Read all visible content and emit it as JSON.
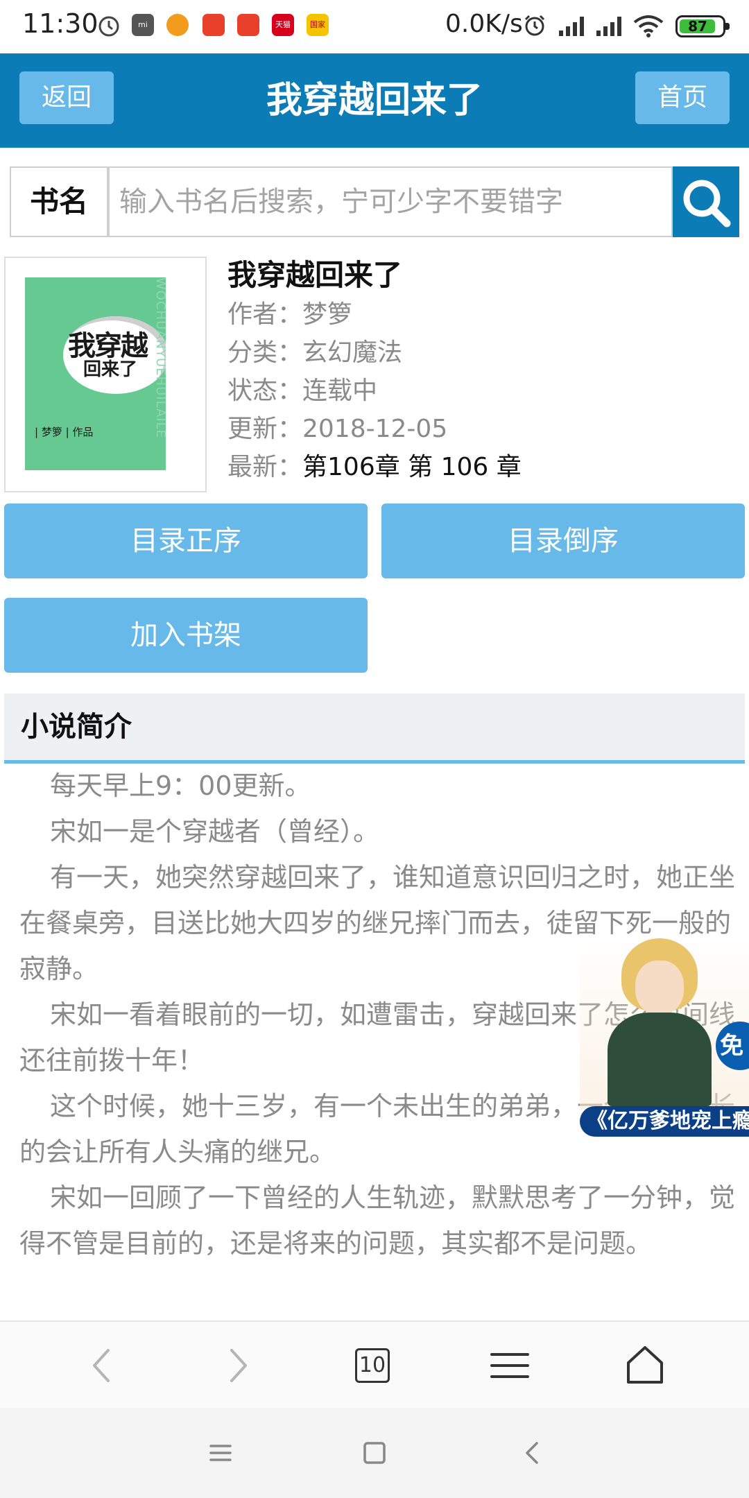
{
  "status_bar": {
    "time": "11:30",
    "net_speed": "0.0K/s",
    "battery": "87",
    "icons": [
      "alarm-icon",
      "mi-icon",
      "app-icon",
      "app-icon",
      "app-icon",
      "tmall-icon",
      "app-icon",
      "alarm-icon",
      "signal-icon",
      "signal-icon",
      "wifi-icon",
      "battery-icon"
    ],
    "app_labels": [
      "天猫",
      "国家"
    ]
  },
  "header": {
    "back_label": "返回",
    "title": "我穿越回来了",
    "home_label": "首页",
    "color": "#0b7cb6",
    "button_color": "#67b9ea"
  },
  "search": {
    "label": "书名",
    "placeholder": "输入书名后搜索，宁可少字不要错字",
    "icon": "search-icon"
  },
  "book": {
    "title": "我穿越回来了",
    "cover": {
      "title_line1": "我穿越",
      "title_line2": "回来了",
      "author": "| 梦箩 | 作品",
      "pinyin": "WOCHUANYUEHUILAILE",
      "color": "#66c992"
    },
    "author_label": "作者：",
    "author": "梦箩",
    "category_label": "分类：",
    "category": "玄幻魔法",
    "status_label": "状态：",
    "status": "连载中",
    "updated_label": "更新：",
    "updated": "2018-12-05",
    "latest_label": "最新：",
    "latest": "第106章 第 106 章"
  },
  "actions": {
    "asc": "目录正序",
    "desc": "目录倒序",
    "shelf": "加入书架"
  },
  "intro": {
    "heading": "小说简介",
    "paragraphs": [
      "每天早上9：00更新。",
      "宋如一是个穿越者（曾经）。",
      "有一天，她突然穿越回来了，谁知道意识回归之时，她正坐在餐桌旁，目送比她大四岁的继兄摔门而去，徒留下死一般的寂静。",
      "宋如一看着眼前的一切，如遭雷击，穿越回来了怎么时间线还往前拨十年！",
      "这个时候，她十三岁，有一个未出生的弟弟，一个叛逆期长的会让所有人头痛的继兄。",
      "宋如一回顾了一下曾经的人生轨迹，默默思考了一分钟，觉得不管是目前的，还是将来的问题，其实都不是问题。"
    ]
  },
  "ad": {
    "badge": "免",
    "caption": "《亿万爹地宠上瘾"
  },
  "toolbar": {
    "tabs_count": "10",
    "icons": [
      "back-arrow-icon",
      "forward-arrow-icon",
      "tabs-icon",
      "menu-icon",
      "home-icon"
    ]
  },
  "system_nav": {
    "icons": [
      "recents-icon",
      "home-square-icon",
      "back-icon"
    ]
  }
}
